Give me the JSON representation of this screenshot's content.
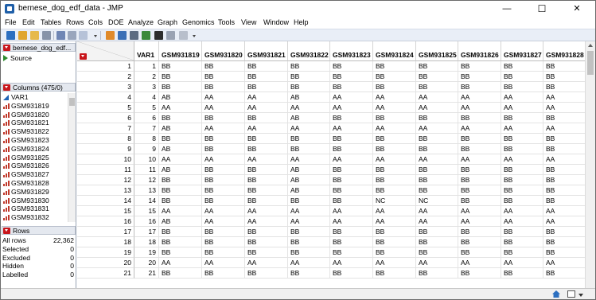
{
  "window": {
    "title": "bernese_dog_edf_data - JMP",
    "minimize_glyph": "—",
    "maximize_glyph": "☐",
    "close_glyph": "✕"
  },
  "menu": [
    "File",
    "Edit",
    "Tables",
    "Rows",
    "Cols",
    "DOE",
    "Analyze",
    "Graph",
    "Genomics",
    "Tools",
    "View",
    "Window",
    "Help"
  ],
  "toolbar_icons": [
    "new-data-table-icon",
    "new-script-icon",
    "open-icon",
    "save-icon",
    "print-icon",
    "cut-icon",
    "copy-icon",
    "paste-icon",
    "data-table-list-icon",
    "show-table-icon",
    "grid-icon",
    "columns-icon",
    "annotate-icon",
    "selection-arrow-icon",
    "drawing-tool-icon"
  ],
  "left_panel": {
    "table_name": "bernese_dog_edf...",
    "source_label": "Source",
    "columns_header": "Columns (475/0)",
    "columns": [
      {
        "name": "VAR1",
        "type": "continuous"
      },
      {
        "name": "GSM931819",
        "type": "nominal"
      },
      {
        "name": "GSM931820",
        "type": "nominal"
      },
      {
        "name": "GSM931821",
        "type": "nominal"
      },
      {
        "name": "GSM931822",
        "type": "nominal"
      },
      {
        "name": "GSM931823",
        "type": "nominal"
      },
      {
        "name": "GSM931824",
        "type": "nominal"
      },
      {
        "name": "GSM931825",
        "type": "nominal"
      },
      {
        "name": "GSM931826",
        "type": "nominal"
      },
      {
        "name": "GSM931827",
        "type": "nominal"
      },
      {
        "name": "GSM931828",
        "type": "nominal"
      },
      {
        "name": "GSM931829",
        "type": "nominal"
      },
      {
        "name": "GSM931830",
        "type": "nominal"
      },
      {
        "name": "GSM931831",
        "type": "nominal"
      },
      {
        "name": "GSM931832",
        "type": "nominal"
      }
    ],
    "rows_header": "Rows",
    "rows_stats": [
      {
        "label": "All rows",
        "value": "22,362"
      },
      {
        "label": "Selected",
        "value": "0"
      },
      {
        "label": "Excluded",
        "value": "0"
      },
      {
        "label": "Hidden",
        "value": "0"
      },
      {
        "label": "Labelled",
        "value": "0"
      }
    ]
  },
  "grid": {
    "headers": [
      "VAR1",
      "GSM931819",
      "GSM931820",
      "GSM931821",
      "GSM931822",
      "GSM931823",
      "GSM931824",
      "GSM931825",
      "GSM931826",
      "GSM931827",
      "GSM931828"
    ],
    "rows": [
      [
        "1",
        "1",
        "BB",
        "BB",
        "BB",
        "BB",
        "BB",
        "BB",
        "BB",
        "BB",
        "BB",
        "BB"
      ],
      [
        "2",
        "2",
        "BB",
        "BB",
        "BB",
        "BB",
        "BB",
        "BB",
        "BB",
        "BB",
        "BB",
        "BB"
      ],
      [
        "3",
        "3",
        "BB",
        "BB",
        "BB",
        "BB",
        "BB",
        "BB",
        "BB",
        "BB",
        "BB",
        "BB"
      ],
      [
        "4",
        "4",
        "AB",
        "AA",
        "AA",
        "AB",
        "AA",
        "AA",
        "AA",
        "AA",
        "AA",
        "AA"
      ],
      [
        "5",
        "5",
        "AA",
        "AA",
        "AA",
        "AA",
        "AA",
        "AA",
        "AA",
        "AA",
        "AA",
        "AA"
      ],
      [
        "6",
        "6",
        "BB",
        "BB",
        "BB",
        "AB",
        "BB",
        "BB",
        "BB",
        "BB",
        "BB",
        "BB"
      ],
      [
        "7",
        "7",
        "AB",
        "AA",
        "AA",
        "AA",
        "AA",
        "AA",
        "AA",
        "AA",
        "AA",
        "AA"
      ],
      [
        "8",
        "8",
        "BB",
        "BB",
        "BB",
        "BB",
        "BB",
        "BB",
        "BB",
        "BB",
        "BB",
        "BB"
      ],
      [
        "9",
        "9",
        "AB",
        "BB",
        "BB",
        "BB",
        "BB",
        "BB",
        "BB",
        "BB",
        "BB",
        "BB"
      ],
      [
        "10",
        "10",
        "AA",
        "AA",
        "AA",
        "AA",
        "AA",
        "AA",
        "AA",
        "AA",
        "AA",
        "AA"
      ],
      [
        "11",
        "11",
        "AB",
        "BB",
        "BB",
        "AB",
        "BB",
        "BB",
        "BB",
        "BB",
        "BB",
        "BB"
      ],
      [
        "12",
        "12",
        "BB",
        "BB",
        "BB",
        "AB",
        "BB",
        "BB",
        "BB",
        "BB",
        "BB",
        "BB"
      ],
      [
        "13",
        "13",
        "BB",
        "BB",
        "BB",
        "AB",
        "BB",
        "BB",
        "BB",
        "BB",
        "BB",
        "BB"
      ],
      [
        "14",
        "14",
        "BB",
        "BB",
        "BB",
        "BB",
        "BB",
        "NC",
        "NC",
        "BB",
        "BB",
        "BB"
      ],
      [
        "15",
        "15",
        "AA",
        "AA",
        "AA",
        "AA",
        "AA",
        "AA",
        "AA",
        "AA",
        "AA",
        "AA"
      ],
      [
        "16",
        "16",
        "AB",
        "AA",
        "AA",
        "AA",
        "AA",
        "AA",
        "AA",
        "AA",
        "AA",
        "AA"
      ],
      [
        "17",
        "17",
        "BB",
        "BB",
        "BB",
        "BB",
        "BB",
        "BB",
        "BB",
        "BB",
        "BB",
        "BB"
      ],
      [
        "18",
        "18",
        "BB",
        "BB",
        "BB",
        "BB",
        "BB",
        "BB",
        "BB",
        "BB",
        "BB",
        "BB"
      ],
      [
        "19",
        "19",
        "BB",
        "BB",
        "BB",
        "BB",
        "BB",
        "BB",
        "BB",
        "BB",
        "BB",
        "BB"
      ],
      [
        "20",
        "20",
        "AA",
        "AA",
        "AA",
        "AA",
        "AA",
        "AA",
        "AA",
        "AA",
        "AA",
        "AA"
      ],
      [
        "21",
        "21",
        "BB",
        "BB",
        "BB",
        "BB",
        "BB",
        "BB",
        "BB",
        "BB",
        "BB",
        "BB"
      ]
    ]
  },
  "colors": {
    "accent_red": "#c8161b",
    "continuous_blue": "#1e63b5",
    "toolbar_bg": "#e9eef7"
  }
}
